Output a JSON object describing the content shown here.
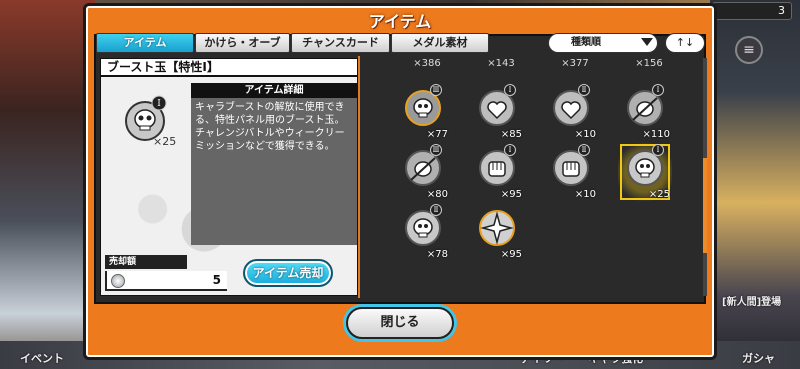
{
  "dialog": {
    "title": "アイテム"
  },
  "tabs": [
    {
      "label": "アイテム",
      "active": true
    },
    {
      "label": "かけら・オーブ",
      "active": false
    },
    {
      "label": "チャンスカード",
      "active": false
    },
    {
      "label": "メダル素材",
      "active": false
    }
  ],
  "sort": {
    "label": "種類順",
    "order_icon": "↑↓"
  },
  "detail": {
    "name": "ブースト玉【特性Ⅰ】",
    "quantity": "×25",
    "rank": "Ⅰ",
    "info_header": "アイテム詳細",
    "description": "キャラブーストの解放に使用できる、特性パネル用のブースト玉。チャレンジバトルやウィークリーミッションなどで獲得できる。",
    "sell_label": "売却額",
    "sell_value": "5",
    "sell_button": "アイテム売却"
  },
  "top_quantities": [
    "×386",
    "×143",
    "×377",
    "×156"
  ],
  "items": [
    {
      "icon": "skull-orb-gold-icon",
      "rank": "Ⅲ",
      "count": "×77",
      "selected": false
    },
    {
      "icon": "heart-orb-icon",
      "rank": "Ⅰ",
      "count": "×85",
      "selected": false
    },
    {
      "icon": "heart-orb-icon",
      "rank": "Ⅱ",
      "count": "×10",
      "selected": false
    },
    {
      "icon": "sword-orb-icon",
      "rank": "Ⅰ",
      "count": "×110",
      "selected": false
    },
    {
      "icon": "sword-orb-icon",
      "rank": "Ⅲ",
      "count": "×80",
      "selected": false
    },
    {
      "icon": "fist-orb-icon",
      "rank": "Ⅰ",
      "count": "×95",
      "selected": false
    },
    {
      "icon": "fist-orb-icon",
      "rank": "Ⅱ",
      "count": "×10",
      "selected": false
    },
    {
      "icon": "skull-orb-icon",
      "rank": "Ⅰ",
      "count": "×25",
      "selected": true
    },
    {
      "icon": "skull-orb-icon",
      "rank": "Ⅱ",
      "count": "×78",
      "selected": false
    },
    {
      "icon": "starburst-orb-icon",
      "rank": "",
      "count": "×95",
      "selected": false
    }
  ],
  "close_button": "閉じる",
  "background": {
    "top_right_count": "3",
    "bottom_left": "イベント",
    "bottom_daily": "デイリー",
    "bottom_chara": "キャラ強化",
    "bottom_gacha": "ガシャ",
    "right_banner": "[新人間]登場"
  },
  "colors": {
    "frame": "#ed7a1d",
    "accent": "#1aa8d8",
    "selected": "#f0c814"
  }
}
